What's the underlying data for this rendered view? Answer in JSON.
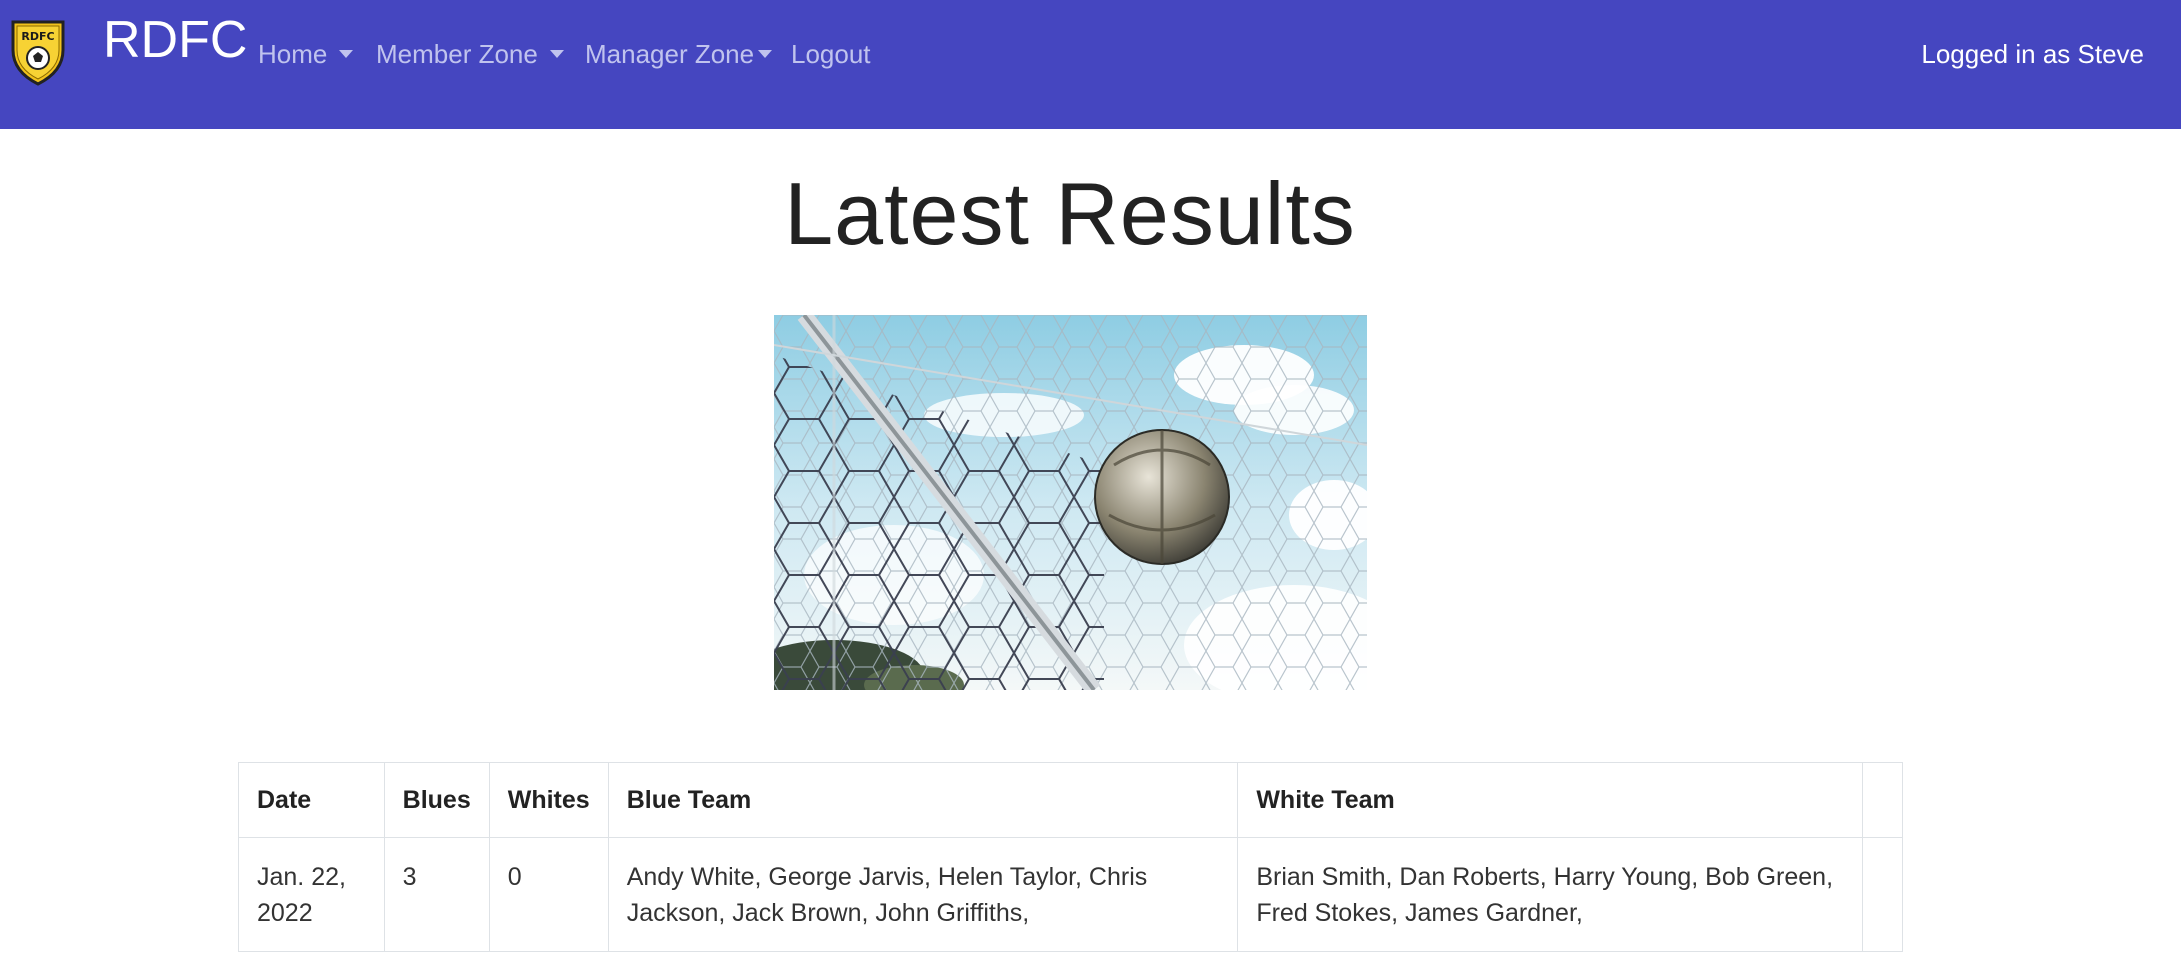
{
  "navbar": {
    "logo_text": "RDFC",
    "brand": "RDFC",
    "items": [
      {
        "label": "Home",
        "dropdown": true
      },
      {
        "label": "Member Zone",
        "dropdown": true
      },
      {
        "label": "Manager Zone",
        "dropdown": true
      },
      {
        "label": "Logout",
        "dropdown": false
      }
    ],
    "user_status": "Logged in as Steve",
    "background_color": "#4546c0"
  },
  "main": {
    "title": "Latest Results",
    "hero_image_icon": "football-in-goal-net-photo"
  },
  "results_table": {
    "columns": [
      "Date",
      "Blues",
      "Whites",
      "Blue Team",
      "White Team",
      ""
    ],
    "rows": [
      {
        "date": "Jan. 22, 2022",
        "blues": "3",
        "whites": "0",
        "blue_team": "Andy White, George Jarvis, Helen Taylor, Chris Jackson, Jack Brown, John Griffiths,",
        "white_team": "Brian Smith, Dan Roberts, Harry Young, Bob Green, Fred Stokes, James Gardner,",
        "extra": ""
      }
    ]
  }
}
